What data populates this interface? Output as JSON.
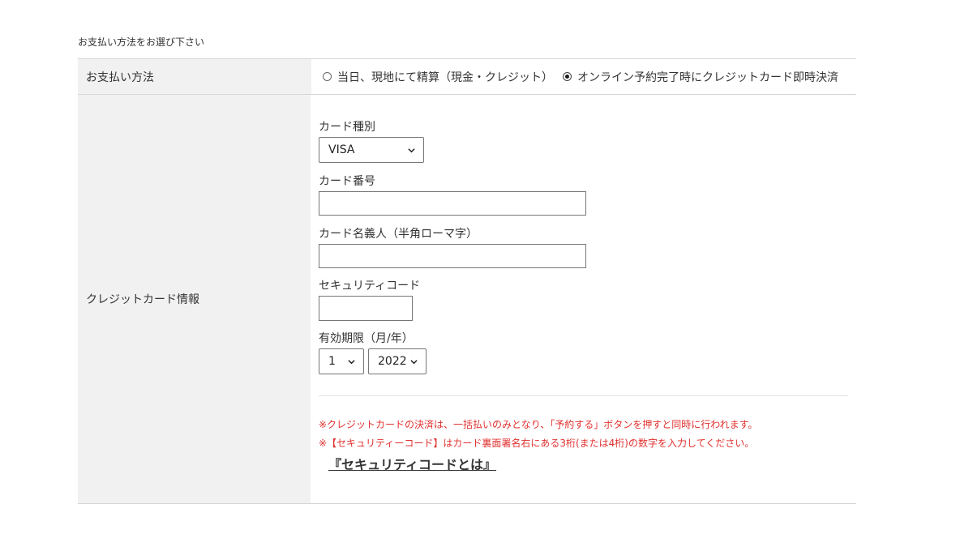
{
  "heading": "お支払い方法をお選び下さい",
  "payment": {
    "label": "お支払い方法",
    "option_onsite": "当日、現地にて精算（現金・クレジット）",
    "option_online": "オンライン予約完了時にクレジットカード即時決済",
    "selected": "online"
  },
  "card": {
    "section_label": "クレジットカード情報",
    "type_label": "カード種別",
    "type_value": "VISA",
    "number_label": "カード番号",
    "number_value": "",
    "holder_label": "カード名義人（半角ローマ字）",
    "holder_value": "",
    "security_label": "セキュリティコード",
    "security_value": "",
    "expiry_label": "有効期限（月/年）",
    "expiry_month": "1",
    "expiry_year": "2022"
  },
  "notes": {
    "note1": "※クレジットカードの決済は、一括払いのみとなり、「予約する」ボタンを押すと同時に行われます。",
    "note2": "※【セキュリティーコード】はカード裏面署名右にある3桁(または4桁)の数字を入力してください。",
    "link": "『セキュリティコードとは』"
  },
  "colors": {
    "label_bg": "#f1f1f1",
    "note_red": "#e0312f"
  },
  "icons": {
    "dropdown": "chevron-down-icon"
  }
}
